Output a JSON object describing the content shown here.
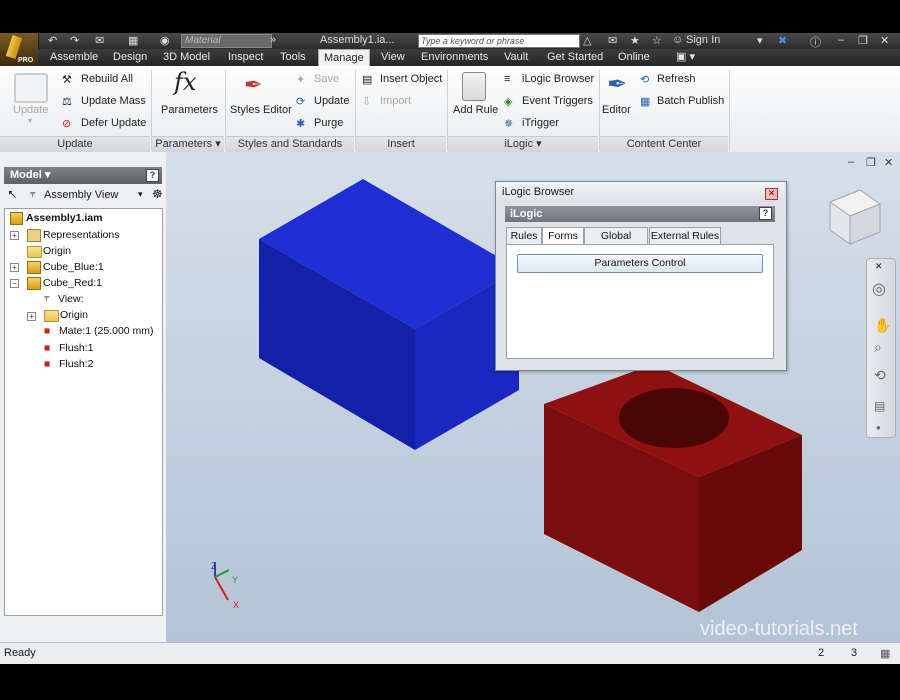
{
  "title_bar": {
    "material_placeholder": "Material",
    "document_title": "Assembly1.ia...",
    "search_placeholder": "Type a keyword or phrase",
    "sign_in": "Sign In"
  },
  "tabs": [
    {
      "label": "Assemble"
    },
    {
      "label": "Design"
    },
    {
      "label": "3D Model"
    },
    {
      "label": "Inspect"
    },
    {
      "label": "Tools"
    },
    {
      "label": "Manage",
      "active": true
    },
    {
      "label": "View"
    },
    {
      "label": "Environments"
    },
    {
      "label": "Vault"
    },
    {
      "label": "Get Started"
    },
    {
      "label": "Online"
    }
  ],
  "ribbon": {
    "update": {
      "label": "Update",
      "rebuild_all": "Rebuild All",
      "update_mass": "Update Mass",
      "defer_update": "Defer Update",
      "panel": "Update"
    },
    "parameters": {
      "label": "Parameters",
      "panel": "Parameters"
    },
    "styles": {
      "styles_editor": "Styles Editor",
      "save": "Save",
      "update": "Update",
      "purge": "Purge",
      "panel": "Styles and Standards"
    },
    "insert": {
      "insert_object": "Insert Object",
      "import": "Import",
      "panel": "Insert"
    },
    "ilogic": {
      "add_rule": "Add Rule",
      "ilogic_browser": "iLogic Browser",
      "event_triggers": "Event Triggers",
      "itrigger": "iTrigger",
      "panel": "iLogic"
    },
    "content_center": {
      "editor": "Editor",
      "refresh": "Refresh",
      "batch_publish": "Batch Publish",
      "panel": "Content Center"
    }
  },
  "model_panel": {
    "header": "Model",
    "view_select": "Assembly View",
    "tree": [
      {
        "label": "Assembly1.iam",
        "bold": true
      },
      {
        "label": "Representations"
      },
      {
        "label": "Origin"
      },
      {
        "label": "Cube_Blue:1"
      },
      {
        "label": "Cube_Red:1"
      },
      {
        "label": "View:"
      },
      {
        "label": "Origin"
      },
      {
        "label": "Mate:1 (25.000 mm)"
      },
      {
        "label": "Flush:1"
      },
      {
        "label": "Flush:2"
      }
    ]
  },
  "dialog": {
    "title": "iLogic Browser",
    "header": "iLogic",
    "tabs": [
      {
        "label": "Rules"
      },
      {
        "label": "Forms",
        "active": true
      },
      {
        "label": "Global Forms"
      },
      {
        "label": "External Rules"
      }
    ],
    "button": "Parameters Control"
  },
  "viewport": {
    "watermark": "video-tutorials.net",
    "colors": {
      "blue_cube": "#1a2fbf",
      "red_cube": "#8a1010",
      "background": "#c6d3e1"
    }
  },
  "status": {
    "text": "Ready",
    "count1": "2",
    "count2": "3"
  }
}
